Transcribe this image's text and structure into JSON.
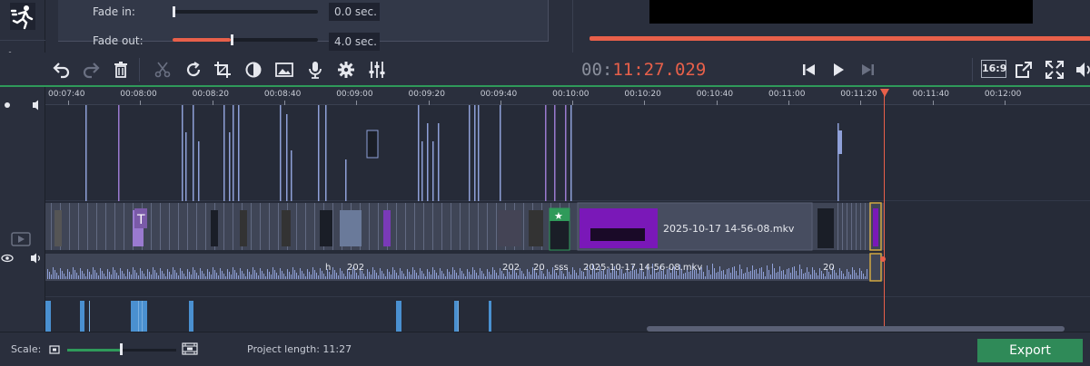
{
  "properties": {
    "fade_in": {
      "label": "Fade in:",
      "value": "0.0 sec.",
      "fraction": 0.0
    },
    "fade_out": {
      "label": "Fade out:",
      "value": "4.0 sec.",
      "fraction": 0.4
    }
  },
  "preview": {
    "progress_fraction": 1.0
  },
  "toolbar": {
    "timecode_dim": "00:",
    "timecode_active": "11:27.029",
    "aspect_ratio": "16:9"
  },
  "ruler": {
    "labels": [
      "00:07:40",
      "00:08:00",
      "00:08:20",
      "00:08:40",
      "00:09:00",
      "00:09:20",
      "00:09:40",
      "00:10:00",
      "00:10:20",
      "00:10:40",
      "00:11:00",
      "00:11:20",
      "00:11:40",
      "00:12:00"
    ]
  },
  "main_track": {
    "clip_title": "2025-10-17 14-56-08.mkv",
    "audio_labels": [
      "h",
      "202",
      "202",
      "20",
      "sss",
      "2025-10-17 14-56-08.mkv",
      "20"
    ]
  },
  "bottom": {
    "scale_label": "Scale:",
    "scale_fraction": 0.48,
    "project_length_label": "Project length:",
    "project_length": "11:27",
    "export_label": "Export"
  },
  "colors": {
    "accent": "#e8604a",
    "green": "#2f9a5a",
    "bg": "#262b38"
  }
}
